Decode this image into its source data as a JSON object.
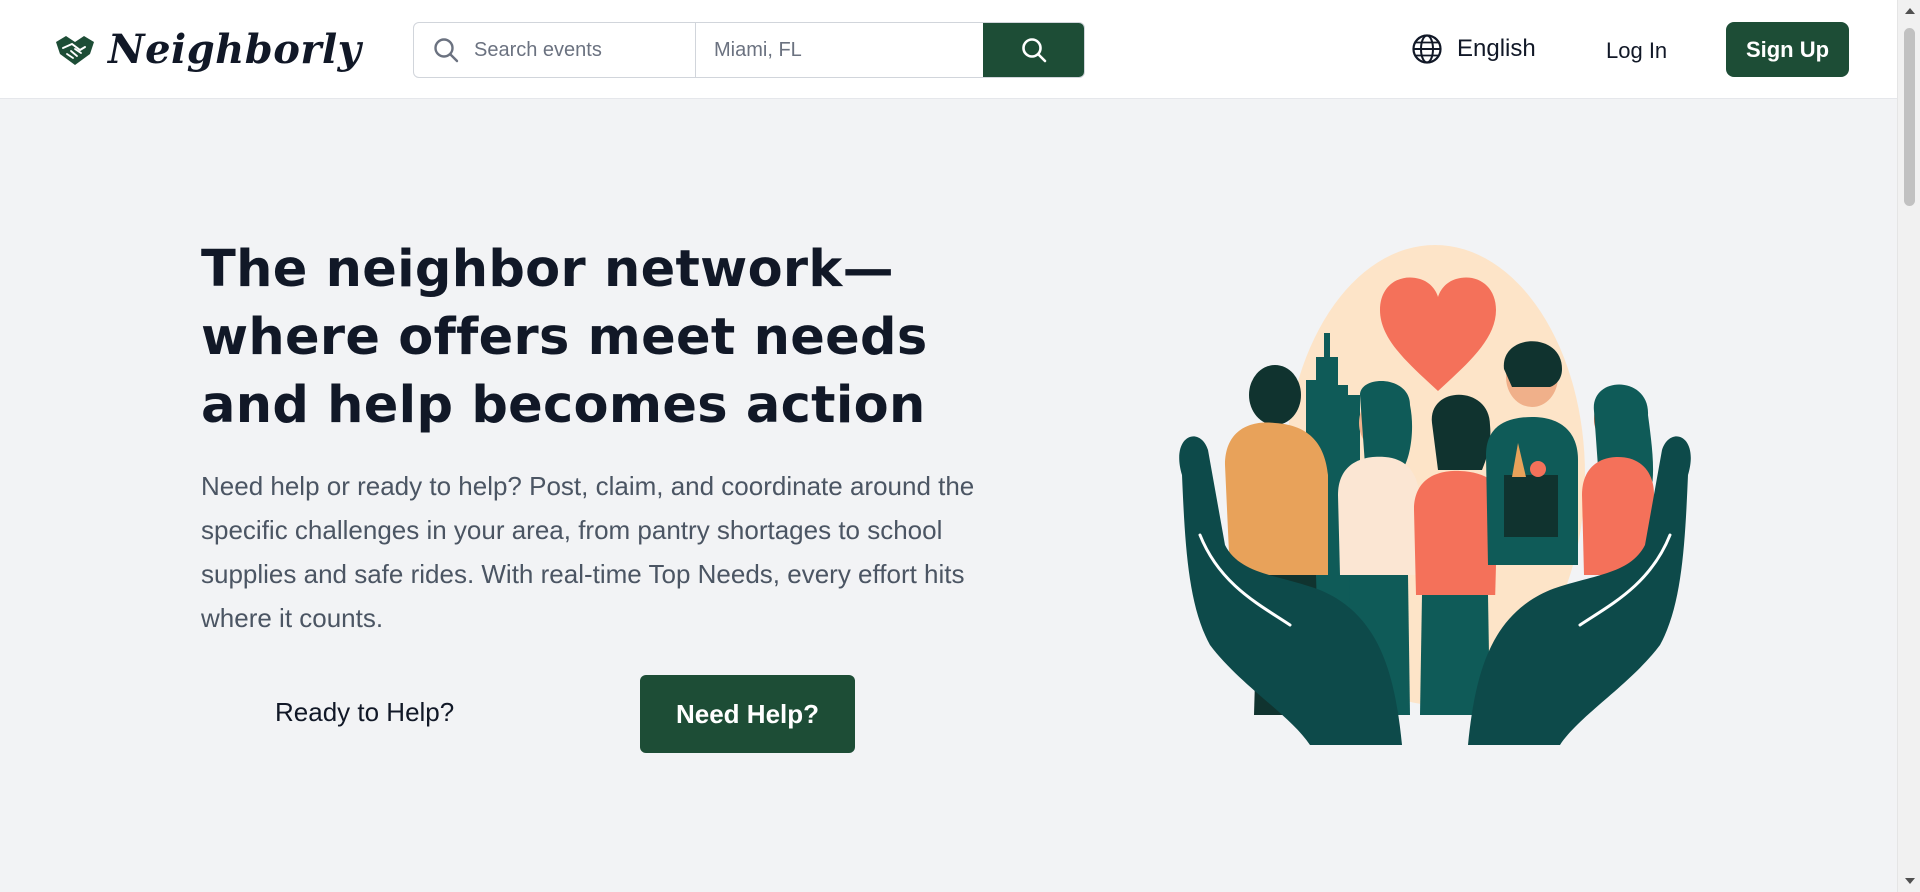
{
  "header": {
    "brand": "Neighborly",
    "search_placeholder": "Search events",
    "location_placeholder": "Miami, FL",
    "language": "English",
    "login": "Log In",
    "signup": "Sign Up"
  },
  "hero": {
    "title": "The neighbor network—where offers meet needs and help becomes action",
    "description": "Need help or ready to help? Post, claim, and coordinate around the specific challenges in your area, from pantry shortages to school supplies and safe rides. With real-time Top Needs, every effort hits where it counts.",
    "ready_button": "Ready to Help?",
    "need_button": "Need Help?"
  },
  "icons": {
    "logo": "handshake-heart-icon",
    "search": "search-icon",
    "language": "globe-icon"
  },
  "colors": {
    "brand_green": "#1d4d36",
    "background": "#f2f3f5",
    "accent_coral": "#f4715a",
    "teal": "#0d4a4a"
  }
}
